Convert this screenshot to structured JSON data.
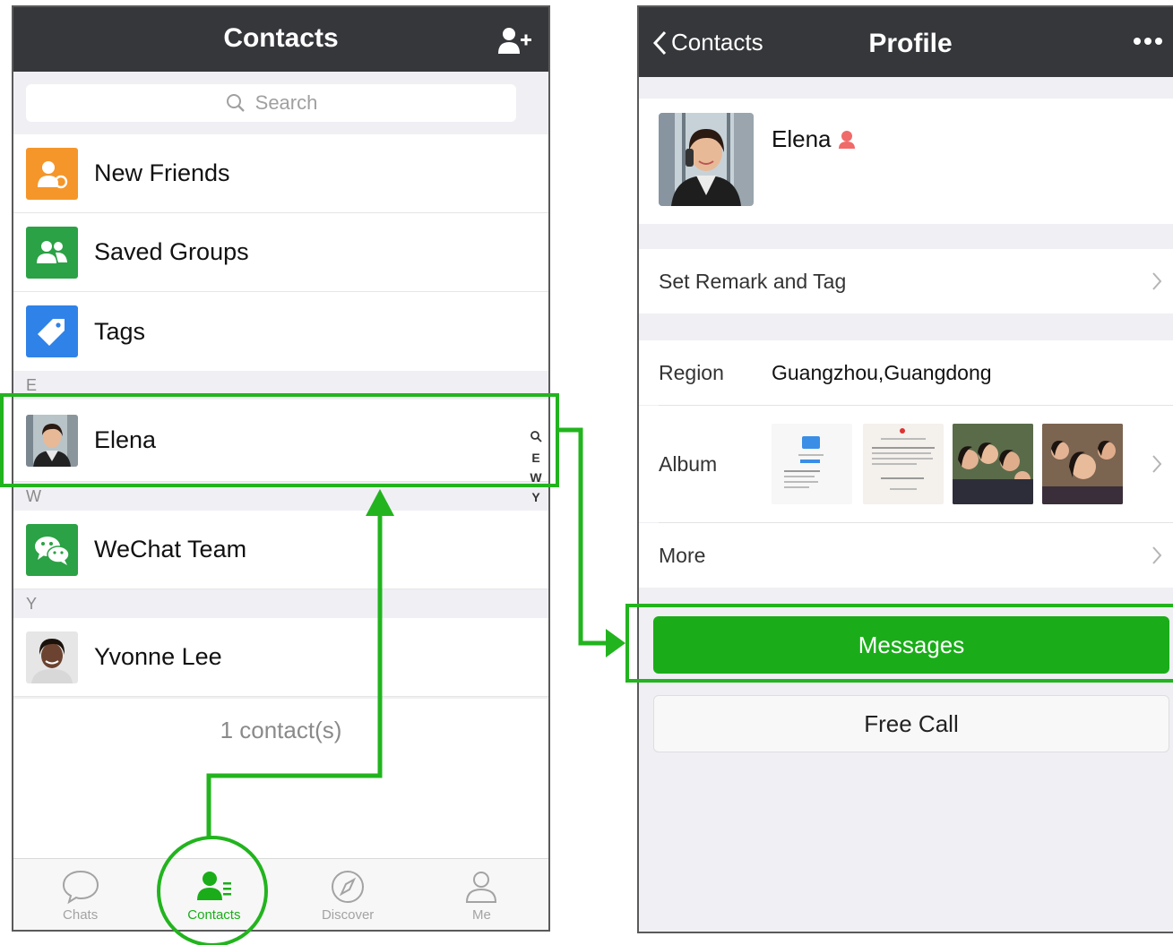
{
  "left": {
    "nav_title": "Contacts",
    "search_placeholder": "Search",
    "menu": [
      {
        "label": "New Friends",
        "icon": "new-friends-icon",
        "color": "#f5962a"
      },
      {
        "label": "Saved Groups",
        "icon": "saved-groups-icon",
        "color": "#2ba245"
      },
      {
        "label": "Tags",
        "icon": "tags-icon",
        "color": "#2f82e8"
      }
    ],
    "sections": [
      {
        "letter": "E",
        "contacts": [
          {
            "name": "Elena"
          }
        ]
      },
      {
        "letter": "W",
        "contacts": [
          {
            "name": "WeChat Team"
          }
        ]
      },
      {
        "letter": "Y",
        "contacts": [
          {
            "name": "Yvonne Lee"
          }
        ]
      }
    ],
    "index": [
      "Q",
      "E",
      "W",
      "Y"
    ],
    "contact_count": "1 contact(s)",
    "tabs": [
      {
        "label": "Chats",
        "icon": "chat-bubble-icon",
        "active": false
      },
      {
        "label": "Contacts",
        "icon": "contacts-icon",
        "active": true
      },
      {
        "label": "Discover",
        "icon": "compass-icon",
        "active": false
      },
      {
        "label": "Me",
        "icon": "person-icon",
        "active": false
      }
    ]
  },
  "right": {
    "back_label": "Contacts",
    "nav_title": "Profile",
    "profile_name": "Elena",
    "remark_label": "Set Remark and Tag",
    "region_label": "Region",
    "region_value": "Guangzhou,Guangdong",
    "album_label": "Album",
    "more_label": "More",
    "messages_button": "Messages",
    "free_call_button": "Free Call"
  },
  "colors": {
    "accent_green": "#1aad19",
    "annotation_green": "#22b41e",
    "navbar": "#36373b"
  }
}
